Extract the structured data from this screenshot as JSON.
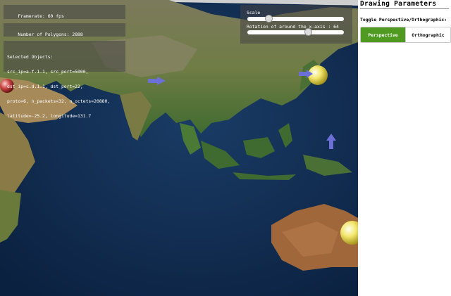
{
  "stats": {
    "framerate": "Framerate: 60 fps",
    "polygons": "Number of Polygons: 2888"
  },
  "selected": {
    "heading": "Selected Objects:",
    "lines": [
      "src_ip=a.f.1.1, src_port=5000,",
      "dst_ip=c.d.1.1, dst_port=22,",
      "proto=6, n_packets=32, n_octets=20880,",
      "latitude=-25.2, longitude=131.7"
    ]
  },
  "sliders": {
    "scale_label": "Scale",
    "rotation_label": "Rotation of around the x-axis : 64",
    "scale_value": 0.2,
    "rotation_value": 0.64
  },
  "sidebar": {
    "title": "Drawing Parameters",
    "toggle_label": "Toggle Perspective/Orthographic:",
    "perspective": "Perspective",
    "orthographic": "Orthographic",
    "active": "Perspective"
  },
  "colors": {
    "active_button": "#4f9b22",
    "ocean": "#0e2a4e"
  }
}
